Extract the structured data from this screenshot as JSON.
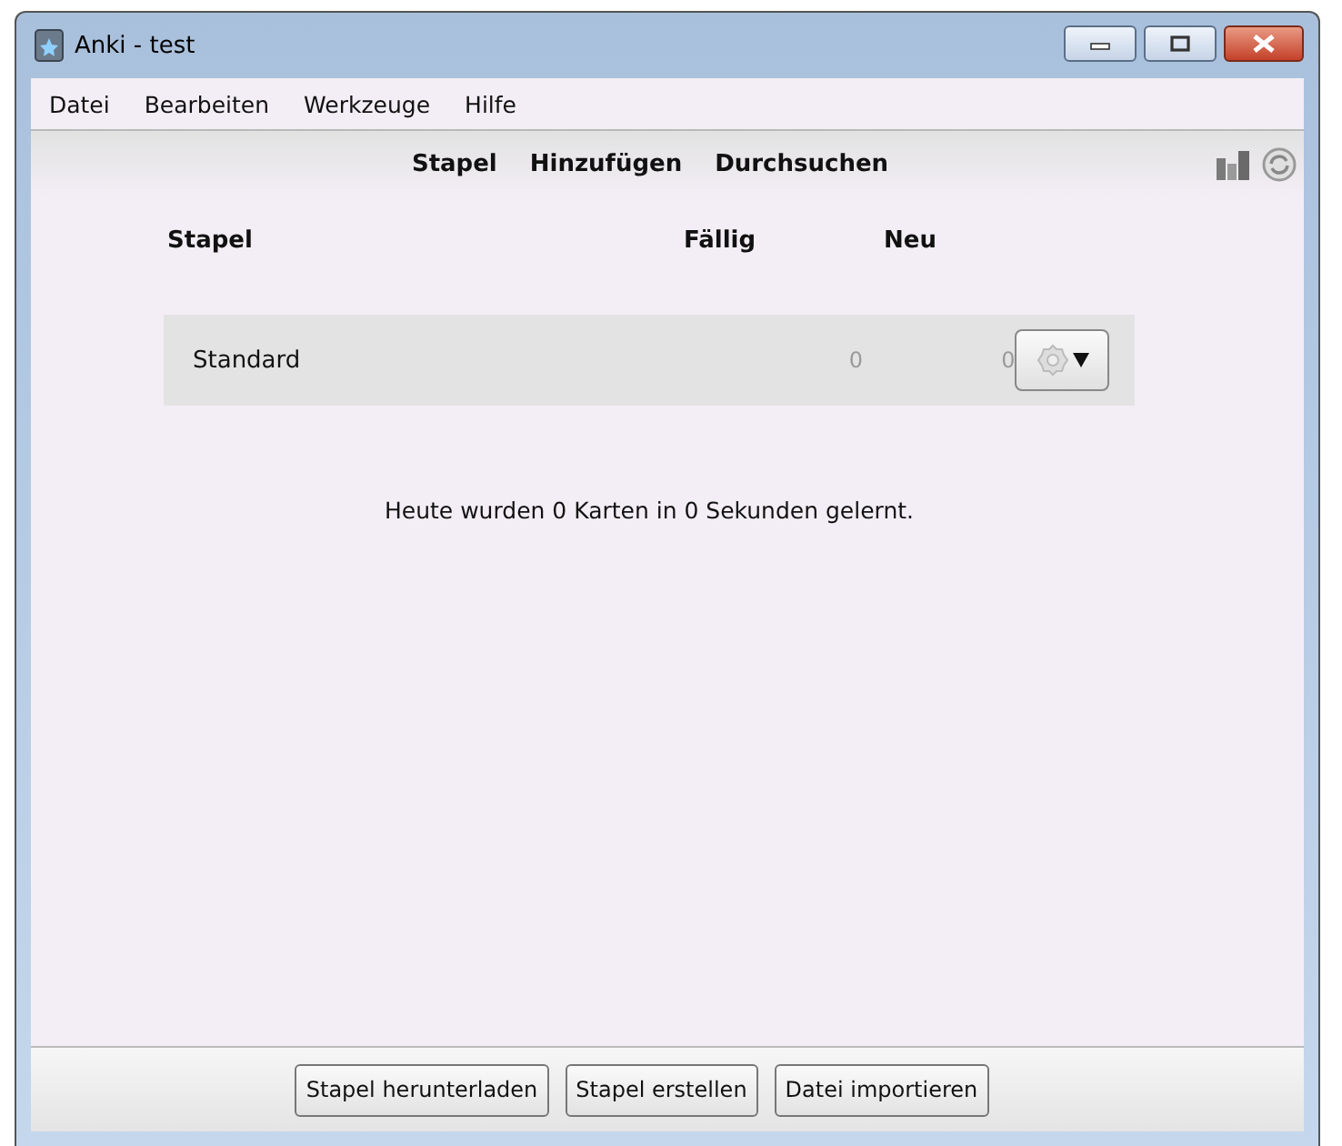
{
  "window": {
    "title": "Anki - test"
  },
  "menu": [
    "Datei",
    "Bearbeiten",
    "Werkzeuge",
    "Hilfe"
  ],
  "toolbar": [
    "Stapel",
    "Hinzufügen",
    "Durchsuchen"
  ],
  "decks": {
    "columns": [
      "Stapel",
      "Fällig",
      "Neu"
    ],
    "rows": [
      {
        "name": "Standard",
        "due": "0",
        "new": "0"
      }
    ]
  },
  "summary": "Heute wurden 0 Karten in 0 Sekunden gelernt.",
  "buttons": [
    "Stapel herunterladen",
    "Stapel erstellen",
    "Datei importieren"
  ]
}
